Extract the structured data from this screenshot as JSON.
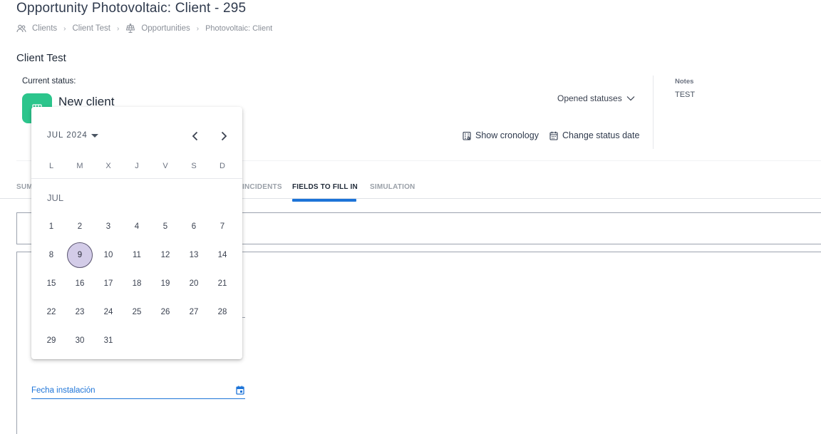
{
  "page": {
    "title": "Opportunity Photovoltaic: Client - 295"
  },
  "breadcrumb": {
    "items": [
      {
        "label": "Clients",
        "icon": "users-icon"
      },
      {
        "label": "Client Test"
      },
      {
        "label": "Opportunities",
        "icon": "solar-panel-icon"
      },
      {
        "label": "Photovoltaic: Client"
      }
    ]
  },
  "client": {
    "name": "Client Test"
  },
  "status": {
    "current_label": "Current status:",
    "name": "New client",
    "tile_color": "#2cc58c",
    "opened_statuses_label": "Opened statuses",
    "show_cronology_label": "Show cronology",
    "change_status_date_label": "Change status date"
  },
  "notes": {
    "label": "Notes",
    "value": "TEST"
  },
  "tabs": [
    {
      "label": "SUM"
    },
    {
      "label": "INCIDENTS"
    },
    {
      "label": "FIELDS TO FILL IN",
      "active": true
    },
    {
      "label": "SIMULATION"
    }
  ],
  "form": {
    "date_field_label": "Fecha instalación",
    "accent_color": "#1d74d8"
  },
  "calendar": {
    "period_label": "JUL 2024",
    "month_label": "JUL",
    "weekdays": [
      "L",
      "M",
      "X",
      "J",
      "V",
      "S",
      "D"
    ],
    "days": [
      "1",
      "2",
      "3",
      "4",
      "5",
      "6",
      "7",
      "8",
      "9",
      "10",
      "11",
      "12",
      "13",
      "14",
      "15",
      "16",
      "17",
      "18",
      "19",
      "20",
      "21",
      "22",
      "23",
      "24",
      "25",
      "26",
      "27",
      "28",
      "29",
      "30",
      "31"
    ],
    "first_weekday_index": 0,
    "selected_day": "9",
    "selected_color": "#d3cce8"
  }
}
